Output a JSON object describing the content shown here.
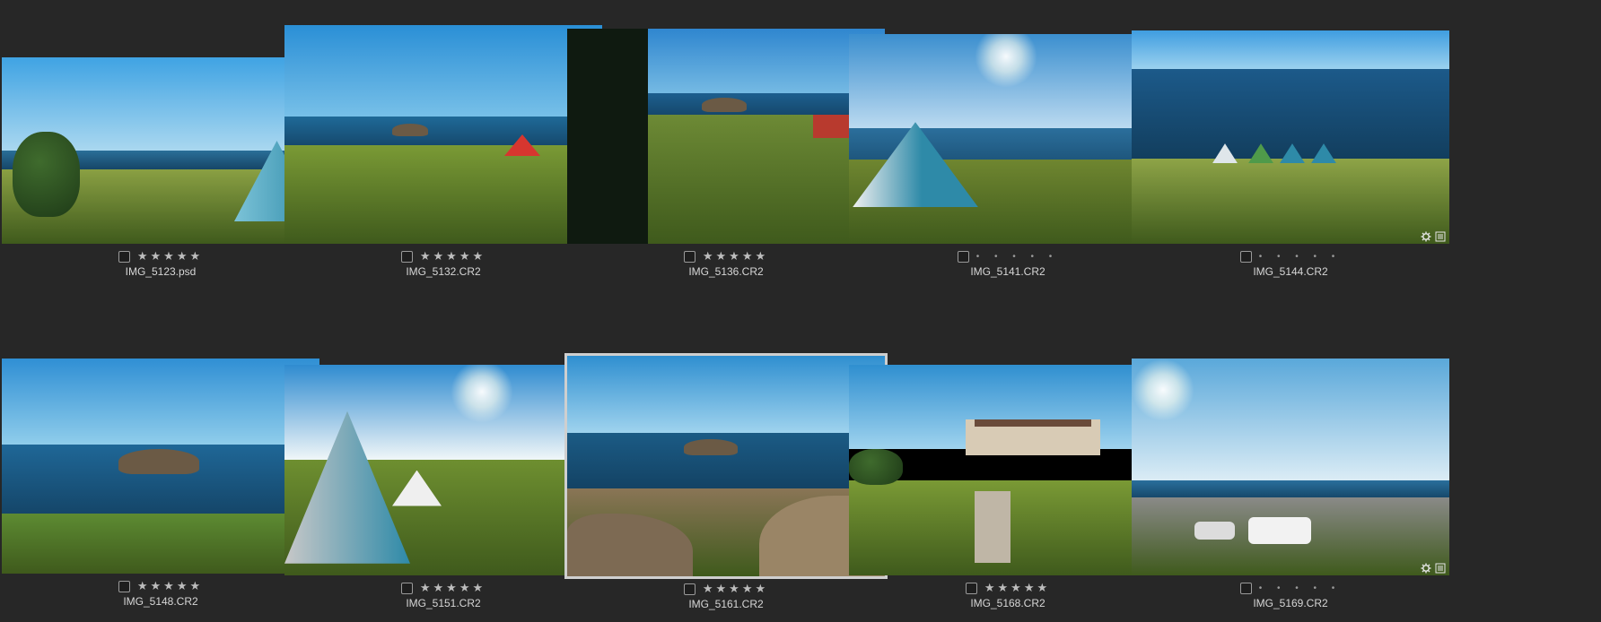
{
  "thumbnails": [
    {
      "filename": "IMG_5123.psd",
      "rating_display": "★★★★★",
      "rating_style": "stars",
      "selected": false,
      "scene": "tent-field",
      "badges": [
        "gear-icon"
      ]
    },
    {
      "filename": "IMG_5132.CR2",
      "rating_display": "★★★★★",
      "rating_style": "stars",
      "selected": false,
      "scene": "coast-fence",
      "badges": [
        "gear-icon",
        "list-icon"
      ]
    },
    {
      "filename": "IMG_5136.CR2",
      "rating_display": "★★★★★",
      "rating_style": "stars",
      "selected": false,
      "scene": "campsite",
      "badges": [
        "gear-icon",
        "list-icon"
      ]
    },
    {
      "filename": "IMG_5141.CR2",
      "rating_display": "• • • • •",
      "rating_style": "dots",
      "selected": false,
      "scene": "tent-sun",
      "badges": [
        "gear-icon",
        "list-icon"
      ]
    },
    {
      "filename": "IMG_5144.CR2",
      "rating_display": "• • • • •",
      "rating_style": "dots",
      "selected": false,
      "scene": "ocean-tents",
      "badges": [
        "gear-icon",
        "list-icon"
      ]
    },
    {
      "filename": "IMG_5148.CR2",
      "rating_display": "★★★★★",
      "rating_style": "stars",
      "selected": false,
      "scene": "island-bay",
      "badges": [
        "gear-icon",
        "list-icon"
      ]
    },
    {
      "filename": "IMG_5151.CR2",
      "rating_display": "★★★★★",
      "rating_style": "stars",
      "selected": false,
      "scene": "tent-closeup",
      "badges": [
        "gear-icon",
        "list-icon"
      ]
    },
    {
      "filename": "IMG_5161.CR2",
      "rating_display": "★★★★★",
      "rating_style": "stars",
      "selected": true,
      "scene": "rocky-shore",
      "badges": [
        "gear-icon",
        "list-icon"
      ]
    },
    {
      "filename": "IMG_5168.CR2",
      "rating_display": "★★★★★",
      "rating_style": "stars",
      "selected": false,
      "scene": "hotel-park",
      "badges": [
        "gear-icon",
        "list-icon"
      ]
    },
    {
      "filename": "IMG_5169.CR2",
      "rating_display": "• • • • •",
      "rating_style": "dots",
      "selected": false,
      "scene": "parking-sun",
      "badges": [
        "gear-icon",
        "list-icon"
      ]
    }
  ],
  "colors": {
    "background": "#272727",
    "sky": "#2f8fd0",
    "sea": "#1c5f8a",
    "grass": "#6f8a2e",
    "tent_blue": "#2e8aa8"
  }
}
